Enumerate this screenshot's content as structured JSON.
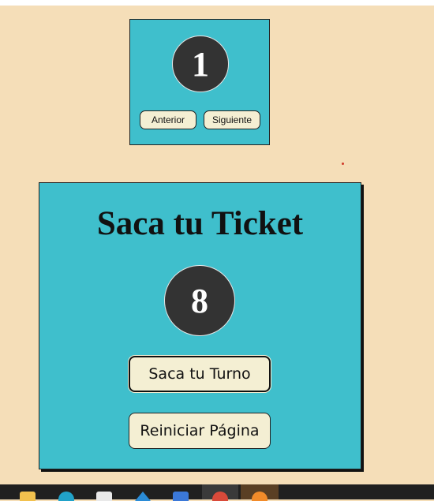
{
  "turn_panel": {
    "current_turn": "1",
    "prev_label": "Anterior",
    "next_label": "Siguiente"
  },
  "ticket_panel": {
    "title": "Saca tu Ticket",
    "ticket_number": "8",
    "take_turn_label": "Saca tu Turno",
    "reset_label": "Reiniciar Página"
  },
  "taskbar": {
    "icons": [
      "folder-icon",
      "edge-icon",
      "store-icon",
      "vscode-icon",
      "mail-icon",
      "chrome-icon",
      "firefox-icon"
    ]
  },
  "colors": {
    "page_background": "#f5deb8",
    "panel_background": "#3fbfcc",
    "circle_background": "#333333",
    "button_background": "#f4efd3"
  }
}
